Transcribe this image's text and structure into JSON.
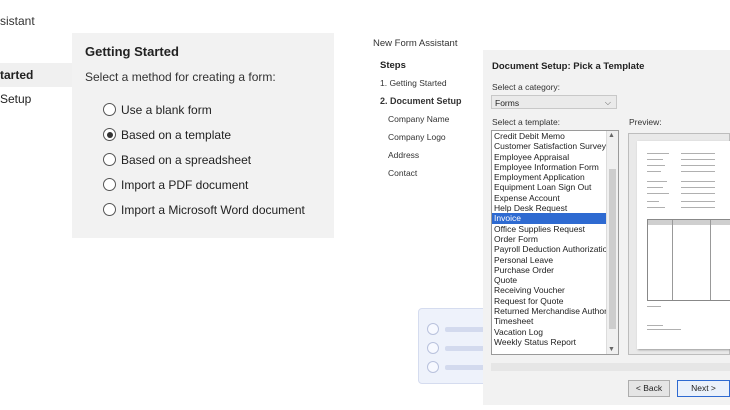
{
  "left_window": {
    "title": "sistant",
    "steps": [
      "tarted",
      "Setup"
    ],
    "heading": "Getting Started",
    "prompt": "Select a method for creating a form:",
    "options": [
      {
        "label": "Use a blank form",
        "selected": false
      },
      {
        "label": "Based on a template",
        "selected": true
      },
      {
        "label": "Based on a spreadsheet",
        "selected": false
      },
      {
        "label": "Import a PDF document",
        "selected": false
      },
      {
        "label": "Import a Microsoft Word document",
        "selected": false
      }
    ]
  },
  "right_window": {
    "title": "New Form Assistant",
    "steps_heading": "Steps",
    "steps": [
      {
        "label": "1. Getting Started",
        "active": false
      },
      {
        "label": "2. Document Setup",
        "active": true
      },
      {
        "label": "Company Name",
        "active": false
      },
      {
        "label": "Company Logo",
        "active": false
      },
      {
        "label": "Address",
        "active": false
      },
      {
        "label": "Contact",
        "active": false
      }
    ],
    "dialog": {
      "heading": "Document Setup: Pick a Template",
      "category_label": "Select a category:",
      "category_value": "Forms",
      "template_label": "Select a template:",
      "preview_label": "Preview:",
      "templates": [
        "Credit Debit Memo",
        "Customer Satisfaction Survey",
        "Employee Appraisal",
        "Employee Information Form",
        "Employment Application",
        "Equipment Loan Sign Out",
        "Expense Account",
        "Help Desk Request",
        "Invoice",
        "Office Supplies Request",
        "Order Form",
        "Payroll Deduction Authorization",
        "Personal Leave",
        "Purchase Order",
        "Quote",
        "Receiving Voucher",
        "Request for Quote",
        "Returned Merchandise Authoriz",
        "Timesheet",
        "Vacation Log",
        "Weekly Status Report"
      ],
      "selected_template": "Invoice",
      "back_label": "< Back",
      "next_label": "Next >"
    }
  },
  "colors": {
    "selection": "#2e6ad1",
    "panel": "#f2f2f2"
  }
}
